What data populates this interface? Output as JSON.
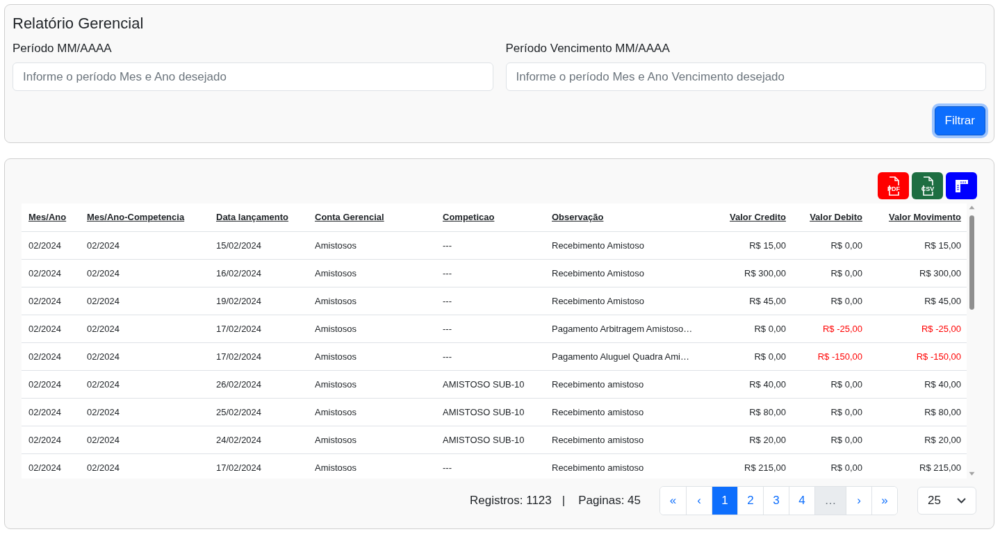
{
  "filter_card": {
    "title": "Relatório Gerencial",
    "fields": [
      {
        "label": "Período MM/AAAA",
        "placeholder": "Informe o período Mes e Ano desejado"
      },
      {
        "label": "Período Vencimento MM/AAAA",
        "placeholder": "Informe o período Mes e Ano Vencimento desejado"
      }
    ],
    "button": "Filtrar"
  },
  "export_buttons": [
    {
      "kind": "pdf",
      "label": "PDF",
      "color": "#ff0000"
    },
    {
      "kind": "csv",
      "label": "CSV",
      "color": "#1e6e42"
    },
    {
      "kind": "columns",
      "color": "#0000ff"
    }
  ],
  "table": {
    "columns": [
      "Mes/Ano",
      "Mes/Ano-Competencia",
      "Data lançamento",
      "Conta Gerencial",
      "Competicao",
      "Observação",
      "Valor Credito",
      "Valor Debito",
      "Valor Movimento"
    ],
    "rows": [
      {
        "cells": [
          "02/2024",
          "02/2024",
          "15/02/2024",
          "Amistosos",
          "---",
          "Recebimento Amistoso"
        ],
        "amounts": [
          {
            "text": "R$ 15,00",
            "negative": false
          },
          {
            "text": "R$ 0,00",
            "negative": false
          },
          {
            "text": "R$ 15,00",
            "negative": false
          }
        ]
      },
      {
        "cells": [
          "02/2024",
          "02/2024",
          "16/02/2024",
          "Amistosos",
          "---",
          "Recebimento Amistoso"
        ],
        "amounts": [
          {
            "text": "R$ 300,00",
            "negative": false
          },
          {
            "text": "R$ 0,00",
            "negative": false
          },
          {
            "text": "R$ 300,00",
            "negative": false
          }
        ]
      },
      {
        "cells": [
          "02/2024",
          "02/2024",
          "19/02/2024",
          "Amistosos",
          "---",
          "Recebimento Amistoso"
        ],
        "amounts": [
          {
            "text": "R$ 45,00",
            "negative": false
          },
          {
            "text": "R$ 0,00",
            "negative": false
          },
          {
            "text": "R$ 45,00",
            "negative": false
          }
        ]
      },
      {
        "cells": [
          "02/2024",
          "02/2024",
          "17/02/2024",
          "Amistosos",
          "---",
          "Pagamento Arbitragem Amistoso…"
        ],
        "amounts": [
          {
            "text": "R$ 0,00",
            "negative": false
          },
          {
            "text": "R$ -25,00",
            "negative": true
          },
          {
            "text": "R$ -25,00",
            "negative": true
          }
        ]
      },
      {
        "cells": [
          "02/2024",
          "02/2024",
          "17/02/2024",
          "Amistosos",
          "---",
          "Pagamento Aluguel Quadra Ami…"
        ],
        "amounts": [
          {
            "text": "R$ 0,00",
            "negative": false
          },
          {
            "text": "R$ -150,00",
            "negative": true
          },
          {
            "text": "R$ -150,00",
            "negative": true
          }
        ]
      },
      {
        "cells": [
          "02/2024",
          "02/2024",
          "26/02/2024",
          "Amistosos",
          "AMISTOSO SUB-10",
          "Recebimento amistoso"
        ],
        "amounts": [
          {
            "text": "R$ 40,00",
            "negative": false
          },
          {
            "text": "R$ 0,00",
            "negative": false
          },
          {
            "text": "R$ 40,00",
            "negative": false
          }
        ]
      },
      {
        "cells": [
          "02/2024",
          "02/2024",
          "25/02/2024",
          "Amistosos",
          "AMISTOSO SUB-10",
          "Recebimento amistoso"
        ],
        "amounts": [
          {
            "text": "R$ 80,00",
            "negative": false
          },
          {
            "text": "R$ 0,00",
            "negative": false
          },
          {
            "text": "R$ 80,00",
            "negative": false
          }
        ]
      },
      {
        "cells": [
          "02/2024",
          "02/2024",
          "24/02/2024",
          "Amistosos",
          "AMISTOSO SUB-10",
          "Recebimento amistoso"
        ],
        "amounts": [
          {
            "text": "R$ 20,00",
            "negative": false
          },
          {
            "text": "R$ 0,00",
            "negative": false
          },
          {
            "text": "R$ 20,00",
            "negative": false
          }
        ]
      },
      {
        "cells": [
          "02/2024",
          "02/2024",
          "17/02/2024",
          "Amistosos",
          "---",
          "Recebimento amistoso"
        ],
        "amounts": [
          {
            "text": "R$ 215,00",
            "negative": false
          },
          {
            "text": "R$ 0,00",
            "negative": false
          },
          {
            "text": "R$ 215,00",
            "negative": false
          }
        ]
      }
    ]
  },
  "footer": {
    "records": "Registros: 1123",
    "separator": "|",
    "pages": "Paginas: 45",
    "pagination": [
      {
        "label": "«",
        "kind": "nav",
        "selected": false
      },
      {
        "label": "‹",
        "kind": "nav",
        "selected": false
      },
      {
        "label": "1",
        "kind": "page",
        "selected": true
      },
      {
        "label": "2",
        "kind": "page",
        "selected": false
      },
      {
        "label": "3",
        "kind": "page",
        "selected": false
      },
      {
        "label": "4",
        "kind": "page",
        "selected": false
      },
      {
        "label": "…",
        "kind": "gap",
        "selected": false
      },
      {
        "label": "›",
        "kind": "nav",
        "selected": false
      },
      {
        "label": "»",
        "kind": "nav",
        "selected": false
      }
    ],
    "page_size": "25"
  }
}
